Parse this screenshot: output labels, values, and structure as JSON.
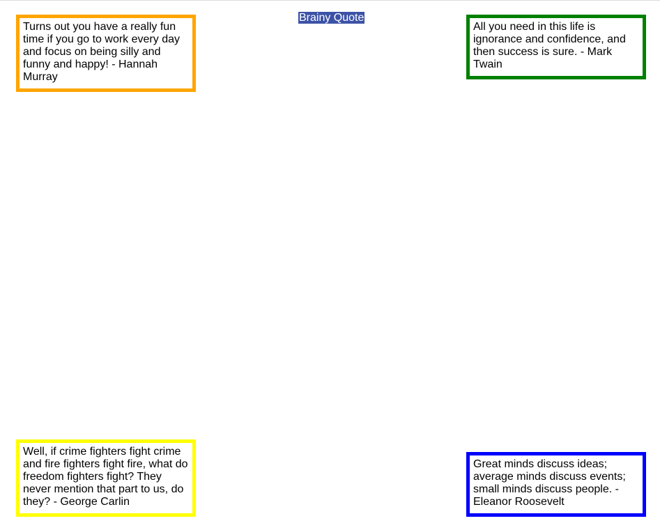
{
  "header": {
    "title": "Brainy Quote",
    "title_highlight_color": "#3c52a6"
  },
  "quotes": [
    {
      "position": "top-left",
      "text": "Turns out you have a really fun time if you go to work every day and focus on being silly and funny and happy! - Hannah Murray",
      "border_color": "#ffa500"
    },
    {
      "position": "top-right",
      "text": "All you need in this life is ignorance and confidence, and then success is sure. - Mark Twain",
      "border_color": "#008000"
    },
    {
      "position": "bottom-left",
      "text": "Well, if crime fighters fight crime and fire fighters fight fire, what do freedom fighters fight? They never mention that part to us, do they? - George Carlin",
      "border_color": "#ffff00"
    },
    {
      "position": "bottom-right",
      "text": "Great minds discuss ideas; average minds discuss events; small minds discuss people. - Eleanor Roosevelt",
      "border_color": "#0000ff"
    }
  ]
}
